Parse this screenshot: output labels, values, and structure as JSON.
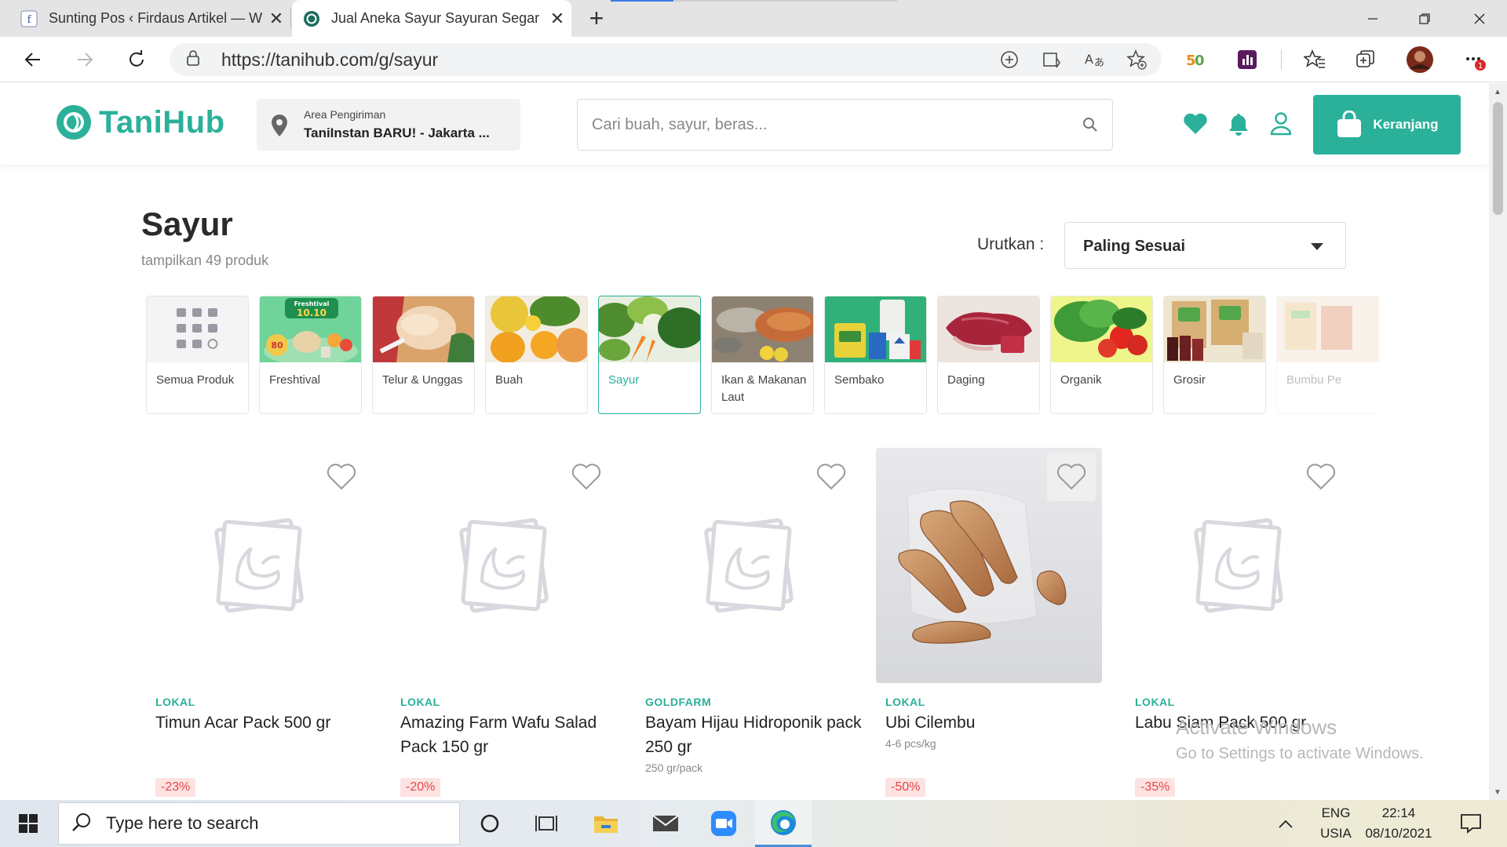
{
  "browser": {
    "tabs": [
      {
        "title": "Sunting Pos ‹ Firdaus Artikel — W"
      },
      {
        "title": "Jual Aneka Sayur Sayuran Segar | T"
      }
    ],
    "url": "https://tanihub.com/g/sayur",
    "profile_badge": "1"
  },
  "header": {
    "logo": "TaniHub",
    "area_label": "Area Pengiriman",
    "area_value": "TaniInstan BARU! - Jakarta ...",
    "search_placeholder": "Cari buah, sayur, beras...",
    "cart_label": "Keranjang"
  },
  "page": {
    "title": "Sayur",
    "subtitle": "tampilkan 49 produk",
    "sort_label": "Urutkan :",
    "sort_value": "Paling Sesuai"
  },
  "categories": [
    {
      "label": "Semua Produk",
      "icon": "grid-icon"
    },
    {
      "label": "Freshtival",
      "banner": "Freshtival 10.10",
      "badge": "80"
    },
    {
      "label": "Telur & Unggas"
    },
    {
      "label": "Buah"
    },
    {
      "label": "Sayur",
      "active": true
    },
    {
      "label": "Ikan & Makanan Laut"
    },
    {
      "label": "Sembako"
    },
    {
      "label": "Daging"
    },
    {
      "label": "Organik"
    },
    {
      "label": "Grosir"
    },
    {
      "label": "Bumbu Pe"
    }
  ],
  "products": [
    {
      "brand": "LOKAL",
      "name": "Timun Acar Pack 500 gr",
      "note": "",
      "discount": "-23%"
    },
    {
      "brand": "LOKAL",
      "name": "Amazing Farm Wafu Salad Pack 150 gr",
      "note": "",
      "discount": "-20%"
    },
    {
      "brand": "GOLDFARM",
      "name": "Bayam Hijau Hidroponik pack 250 gr",
      "note": "250 gr/pack",
      "discount": ""
    },
    {
      "brand": "LOKAL",
      "name": "Ubi Cilembu",
      "note": "4-6 pcs/kg",
      "discount": "-50%"
    },
    {
      "brand": "LOKAL",
      "name": "Labu Siam Pack 500 gr",
      "note": "",
      "discount": "-35%"
    }
  ],
  "watermark": {
    "line1": "Activate Windows",
    "line2": "Go to Settings to activate Windows."
  },
  "taskbar": {
    "search_placeholder": "Type here to search",
    "lang": "ENG",
    "region": "USIA",
    "time": "22:14",
    "date": "08/10/2021"
  },
  "colors": {
    "brand": "#2bb09a",
    "discount_text": "#e24848",
    "discount_bg": "#fde2e2"
  }
}
